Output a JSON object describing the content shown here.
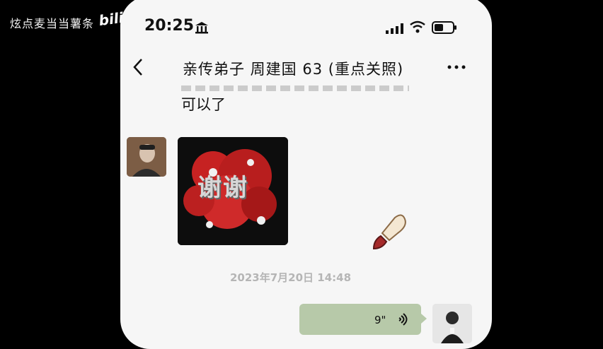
{
  "overlay": {
    "watermark_text": "炫点麦当当薯条",
    "bilibili_logo_text": "bili"
  },
  "status_bar": {
    "time": "20:25",
    "icons": [
      "bank-icon",
      "signal-icon",
      "wifi-icon",
      "battery-icon"
    ]
  },
  "nav": {
    "back_icon": "chevron-left-icon",
    "title": "亲传弟子 周建国 63 (重点关照)",
    "more_icon": "more-icon"
  },
  "chat": {
    "previous_message_text": "可以了",
    "image_message": {
      "caption_glyphs": "谢谢"
    },
    "timestamp": "2023年7月20日 14:48",
    "voice_message": {
      "duration": "9\""
    }
  },
  "colors": {
    "background": "#f6f6f6",
    "voice_bubble": "#b7c9a9",
    "timestamp": "#b5b5b5"
  }
}
